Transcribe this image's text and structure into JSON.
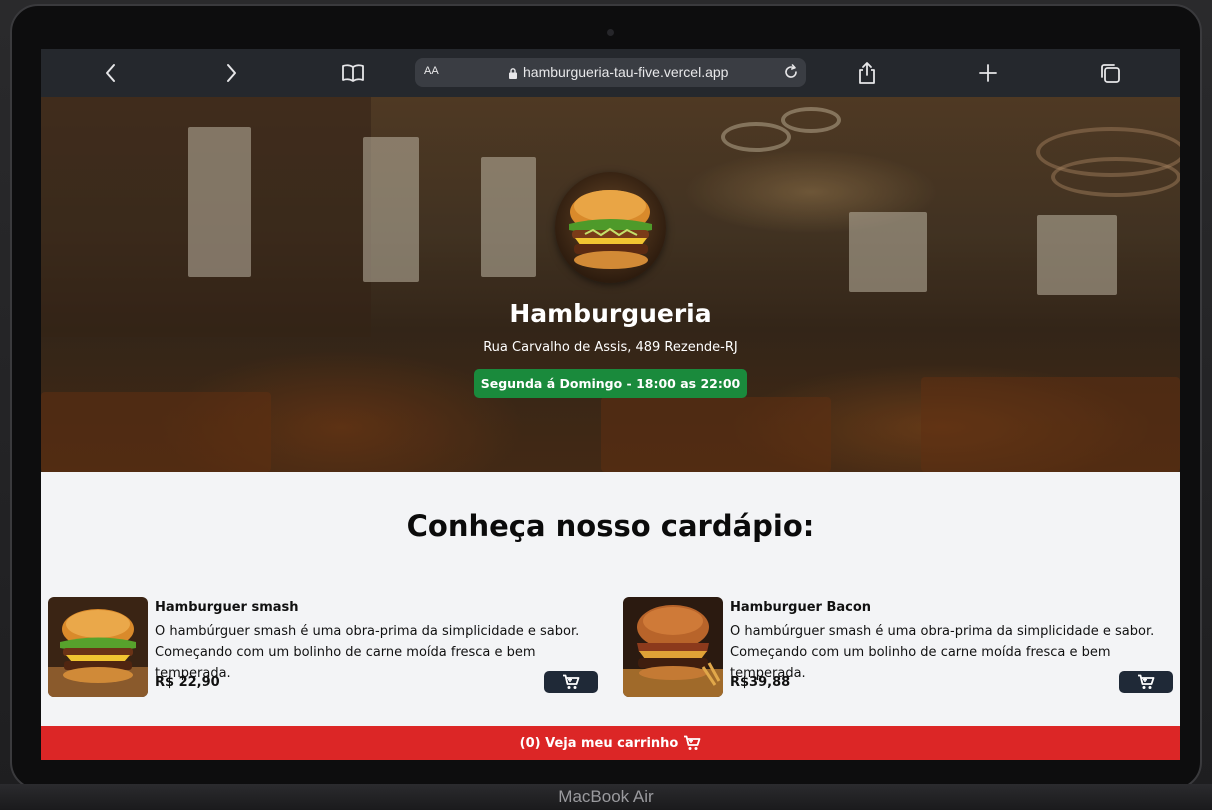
{
  "device": {
    "label": "MacBook Air"
  },
  "browser": {
    "text_size_label": "AA",
    "url": "hamburgueria-tau-five.vercel.app"
  },
  "hero": {
    "title": "Hamburgueria",
    "address": "Rua Carvalho de Assis, 489 Rezende-RJ",
    "hours": "Segunda á Domingo - 18:00 as 22:00",
    "hours_color": "#1a8a3c"
  },
  "menu": {
    "title": "Conheça nosso cardápio:",
    "items": [
      {
        "name": "Hamburguer smash",
        "description": "O hambúrguer smash é uma obra-prima da simplicidade e sabor. Começando com um bolinho de carne moída fresca e bem temperada.",
        "price": "R$ 22,90",
        "icon": "add-to-cart-icon"
      },
      {
        "name": "Hamburguer Bacon",
        "description": "O hambúrguer smash é uma obra-prima da simplicidade e sabor. Começando com um bolinho de carne moída fresca e bem temperada.",
        "price": "R$39,88",
        "icon": "add-to-cart-icon"
      }
    ]
  },
  "cart": {
    "label": "(0) Veja meu carrinho",
    "bar_color": "#dc2626",
    "icon": "cart-icon"
  }
}
